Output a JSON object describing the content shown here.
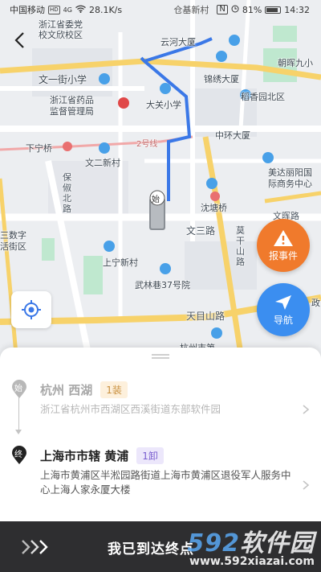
{
  "status": {
    "carrier": "中国移动",
    "network_badge": "HD",
    "network_type": "4G",
    "speed": "28.1K/s",
    "battery_percent": "81%",
    "time": "14:32",
    "notification_label": "仓基新村"
  },
  "map": {
    "labels": {
      "prov_committee": "浙江省委党\n校文欣校区",
      "yunci": "云河大厦",
      "wenyijie": "文一街小学",
      "drug_admin": "浙江省药品\n监督管理局",
      "jinxiu": "锦绣大厦",
      "daoxiang": "稻香园北区",
      "chaohui": "朝晖九小",
      "daguan": "大关小学",
      "zhonghuan": "中环大厦",
      "xianing": "下宁桥",
      "line2": "2号线",
      "wener": "文二新村",
      "meida": "美达丽阳国\n际商务中心",
      "baoshu": "保\n俶\n北\n路",
      "shentang": "沈塘桥",
      "wensan": "文三路",
      "shuzi": "三数字\n活街区",
      "shangning": "上宁新村",
      "wulin": "武林巷37号院",
      "tianmu": "天目山路",
      "gongchen": "莫\n干\n山\n路",
      "wenhui": "文晖路",
      "hangzhou_school": "杭州市第...",
      "dongfang": "政"
    },
    "truck_badge": "始"
  },
  "controls": {
    "report_label": "报事件",
    "nav_label": "导航"
  },
  "origin": {
    "marker": "始",
    "name": "杭州 西湖",
    "tag": "1装",
    "address": "浙江省杭州市西湖区西溪街道东部软件园"
  },
  "destination": {
    "marker": "终",
    "name": "上海市市辖 黄浦",
    "tag": "1卸",
    "address": "上海市黄浦区半淞园路街道上海市黄浦区退役军人服务中心上海人家永厦大楼"
  },
  "action": {
    "label": "我已到达终点"
  },
  "watermark": {
    "brand_num": "592",
    "brand_text": "软件园",
    "url": "www.592xiazai.com"
  },
  "colors": {
    "route": "#3b78e7",
    "report_button": "#f07a2c",
    "nav_button": "#3b8ef0",
    "load_tag": "#c9903f",
    "unload_tag": "#7a5fd0",
    "action_bar": "#2e2e30"
  }
}
